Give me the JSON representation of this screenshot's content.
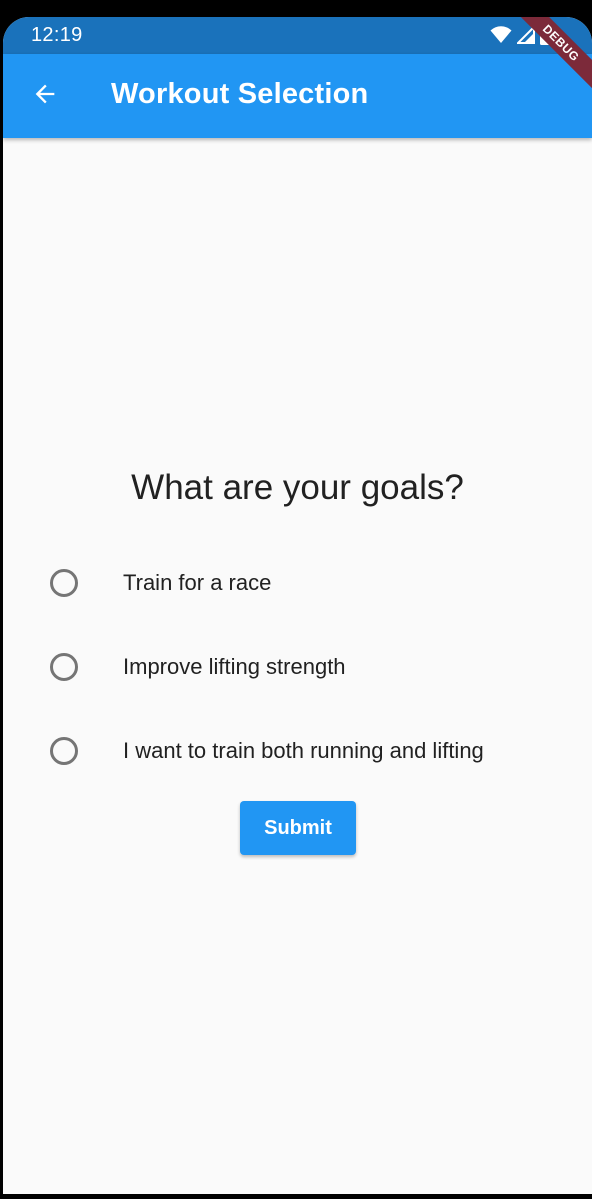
{
  "status_bar": {
    "time": "12:19",
    "icons": [
      "wifi-icon",
      "signal-icon",
      "battery-icon"
    ]
  },
  "app_bar": {
    "back_icon": "arrow-back-icon",
    "title": "Workout Selection",
    "background_color": "#2196f3"
  },
  "debug_banner": {
    "label": "DEBUG"
  },
  "form": {
    "question": "What are your goals?",
    "options": [
      {
        "label": "Train for a race",
        "selected": false
      },
      {
        "label": "Improve lifting strength",
        "selected": false
      },
      {
        "label": "I want to train both running and lifting",
        "selected": false
      }
    ],
    "submit_label": "Submit"
  },
  "colors": {
    "accent": "#2196f3",
    "status_bar": "#1a72bb",
    "background": "#fafafa",
    "radio_border": "#757575"
  }
}
